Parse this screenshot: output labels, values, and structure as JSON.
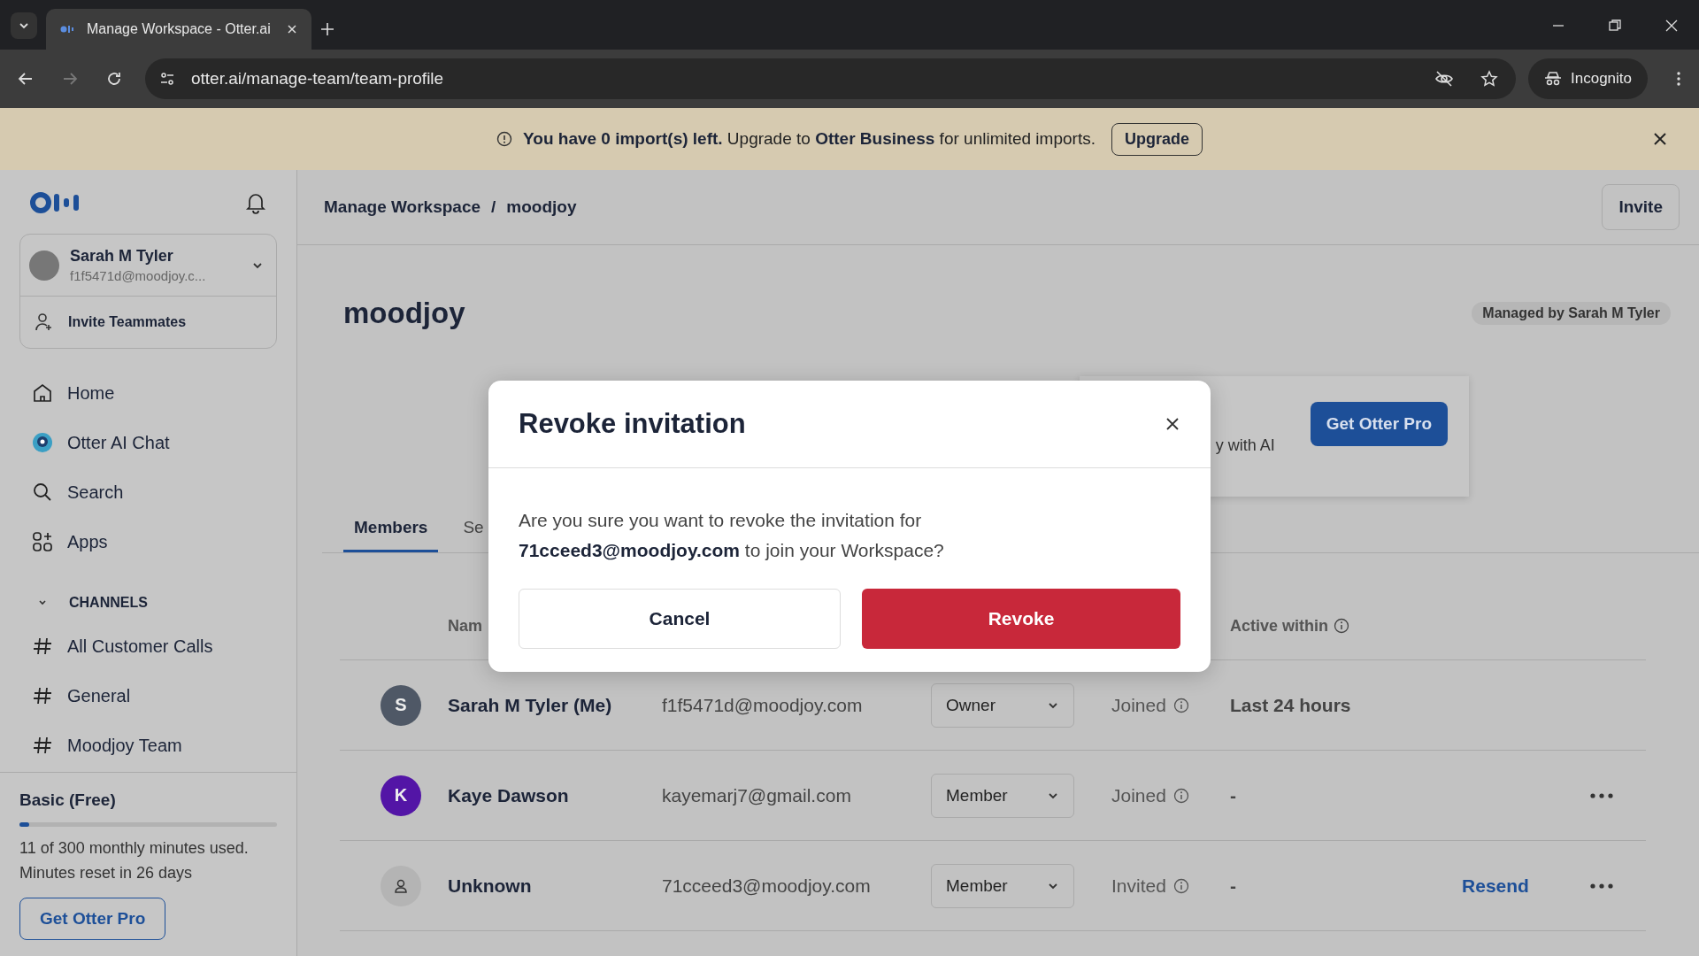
{
  "browser": {
    "tab_title": "Manage Workspace - Otter.ai",
    "url": "otter.ai/manage-team/team-profile",
    "profile": "Incognito"
  },
  "banner": {
    "message": "**You have 0 import(s) left.** Upgrade to **Otter Business** for unlimited imports.",
    "button": "Upgrade"
  },
  "sidebar": {
    "user": {
      "name": "Sarah M Tyler",
      "email": "f1f5471d@moodjoy.c..."
    },
    "invite": "Invite Teammates",
    "nav": [
      {
        "label": "Home",
        "kind": "home"
      },
      {
        "label": "Otter AI Chat",
        "kind": "chat"
      },
      {
        "label": "Search",
        "kind": "search"
      },
      {
        "label": "Apps",
        "kind": "apps"
      }
    ],
    "channels_header": "CHANNELS",
    "channels": [
      "All Customer Calls",
      "General",
      "Moodjoy Team"
    ],
    "plan": {
      "name": "Basic (Free)",
      "level": 0.037,
      "usage": "11 of 300 monthly minutes used.",
      "reset": "Minutes reset in 26 days",
      "button": "Get Otter Pro"
    }
  },
  "header": {
    "breadcrumb": [
      "Manage Workspace",
      "/",
      "moodjoy"
    ],
    "invite": "Invite"
  },
  "workspace": {
    "title": "moodjoy",
    "managed_by": "Managed by Sarah M Tyler",
    "promo_text": "y with AI",
    "promo_button": "Get Otter Pro"
  },
  "tabs": [
    {
      "label": "Members",
      "selected": true
    },
    {
      "label": "Se",
      "selected": false
    }
  ],
  "table": {
    "columns": [
      "Nam",
      "Active within"
    ],
    "rows": [
      {
        "avatar": {
          "kind": "letter",
          "letter": "S",
          "color": "#4f5866"
        },
        "name": "Sarah M Tyler (Me)",
        "email": "f1f5471d@moodjoy.com",
        "role": "Owner",
        "status": "Joined",
        "active": "Last 24 hours",
        "menu": false
      },
      {
        "avatar": {
          "kind": "letter",
          "letter": "K",
          "color": "#5315a6"
        },
        "name": "Kaye Dawson",
        "email": "kayemarj7@gmail.com",
        "role": "Member",
        "status": "Joined",
        "active": "-",
        "menu": true
      },
      {
        "avatar": {
          "kind": "person",
          "color": "#b4b4b4"
        },
        "name": "Unknown",
        "email": "71cceed3@moodjoy.com",
        "role": "Member",
        "status": "Invited",
        "active": "-",
        "action": "Resend",
        "menu": true
      }
    ]
  },
  "dialog": {
    "title": "Revoke invitation",
    "message": "Are you sure you want to revoke the invitation for **71cceed3@moodjoy.com** to join your Workspace?",
    "cancel": "Cancel",
    "confirm": "Revoke"
  }
}
